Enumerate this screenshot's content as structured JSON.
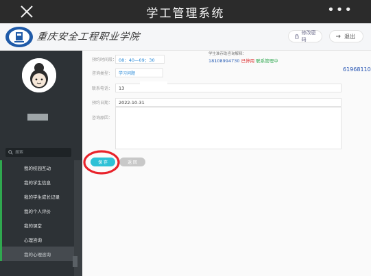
{
  "appbar": {
    "title": "学工管理系统",
    "more": "•••"
  },
  "header": {
    "school_name": "重庆安全工程职业学院",
    "password_button": "修改密码",
    "logout_button": "退出"
  },
  "sidebar": {
    "search_placeholder": "搜索",
    "items": [
      {
        "label": "我的校园互动"
      },
      {
        "label": "我的学生信息"
      },
      {
        "label": "我的学生成长记录"
      },
      {
        "label": "我的个人评价"
      },
      {
        "label": "我的课堂"
      },
      {
        "label": "心理咨询"
      },
      {
        "label": "我的心理咨询"
      }
    ]
  },
  "form": {
    "time_label": "预约时间段：",
    "time_value": "08：40—09：30",
    "type_label": "咨询类型：",
    "type_value": "学习问题",
    "phone_label": "联系电话：",
    "phone_value": "13",
    "date_label": "预约日期：",
    "date_value": "2022-10-31",
    "reason_label": "咨询原因：",
    "notice_line1": "学生准存助咨询解释：",
    "notice_line2": "18108994730",
    "notice_line2_red": "已停用",
    "notice_line2_grn": "联系管理中",
    "phone_overlay": "61968110",
    "save_button": "保 存",
    "back_button": "返 回"
  },
  "colors": {
    "accent": "#2ec1d6",
    "sidebar_bg": "#2d3236",
    "annotation_red": "#e8222a",
    "menu_marker": "#2fa84f"
  }
}
